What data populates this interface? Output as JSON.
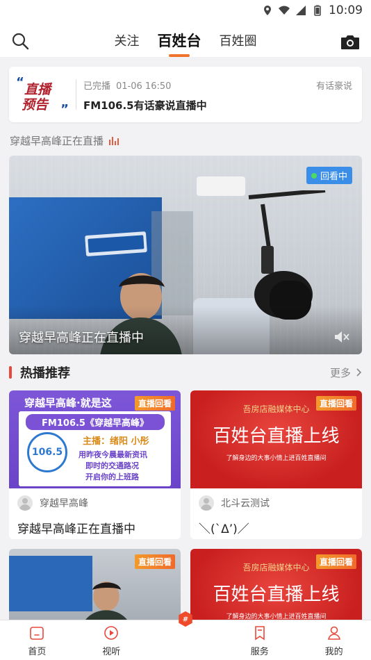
{
  "status_bar": {
    "time": "10:09"
  },
  "header": {
    "tabs": [
      {
        "label": "关注"
      },
      {
        "label": "百姓台"
      },
      {
        "label": "百姓圈"
      }
    ]
  },
  "preview": {
    "logo_line1": "直播",
    "logo_line2": "预告",
    "status": "已完播",
    "datetime": "01-06 16:50",
    "tag": "有话豪说",
    "title": "FM106.5有话豪说直播中"
  },
  "live_now": {
    "text": "穿越早高峰正在直播"
  },
  "hero": {
    "badge": "回看中",
    "caption": "穿越早高峰正在直播中"
  },
  "section": {
    "title": "热播推荐",
    "more": "更多"
  },
  "cards": [
    {
      "badge": "直播回看",
      "author": "穿越早高峰",
      "title": "穿越早高峰正在直播中",
      "poster": {
        "headline": "穿越早高峰·就是这",
        "subhead": "FM106.5《穿越早高峰》",
        "hosts": "主播：绪阳 小彤",
        "line1": "用昨夜今晨最新资讯",
        "line2": "即时的交通路况",
        "line3": "开启你的上班路",
        "logo": "106.5"
      }
    },
    {
      "badge": "直播回看",
      "author": "北斗云测试",
      "title": "＼(`Δ’)／",
      "poster": {
        "org": "吾房店融媒体中心",
        "headline": "百姓台直播上线",
        "sub": "了解身边的大事小情上进百姓直播间"
      }
    },
    {
      "badge": "直播回看"
    },
    {
      "badge": "直播回看",
      "poster": {
        "org": "吾房店融媒体中心",
        "headline": "百姓台直播上线",
        "sub": "了解身边的大事小情上进百姓直播间"
      }
    }
  ],
  "tabbar": {
    "items": [
      {
        "label": "首页"
      },
      {
        "label": "视听"
      },
      {
        "label": ""
      },
      {
        "label": "服务"
      },
      {
        "label": "我的"
      }
    ]
  },
  "colors": {
    "accent": "#f0732c",
    "section_marker": "#e8483a",
    "badge_blue": "#3b8ee8",
    "replay_orange": "#f06a2b"
  }
}
